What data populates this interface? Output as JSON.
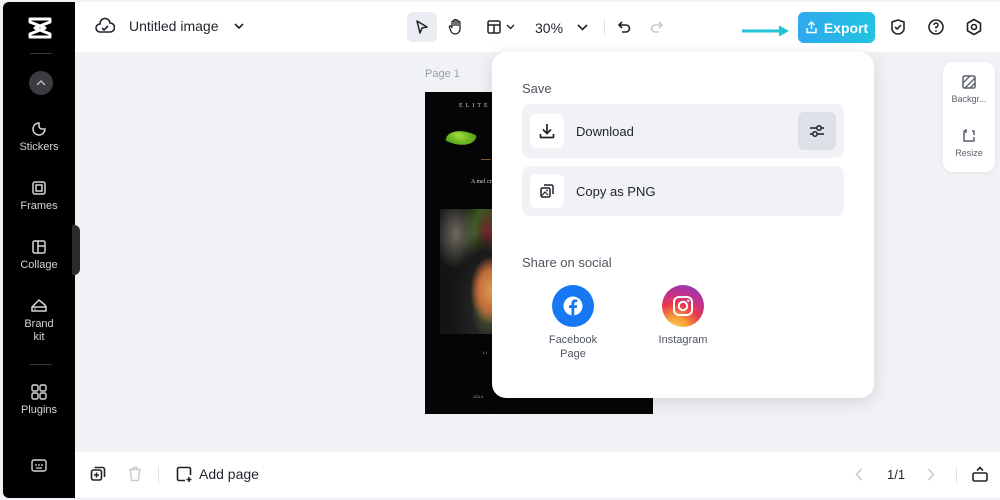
{
  "app": {
    "logo": "capcut-logo-icon"
  },
  "sidebar": {
    "collapse_icon": "chevron-up-icon",
    "items": [
      {
        "label": "Stickers",
        "icon": "sticker-icon"
      },
      {
        "label": "Frames",
        "icon": "frame-icon"
      },
      {
        "label": "Collage",
        "icon": "collage-icon"
      },
      {
        "label": "Brand\nkit",
        "label_line1": "Brand",
        "label_line2": "kit",
        "icon": "brand-kit-icon"
      },
      {
        "label": "Plugins",
        "icon": "plugins-icon"
      }
    ],
    "bottom_icon": "keyboard-shortcuts-icon"
  },
  "header": {
    "cloud_icon": "cloud-saved-icon",
    "title": "Untitled image",
    "zoom": "30%",
    "tools": [
      "select-pointer-icon",
      "hand-pan-icon",
      "layout-icon",
      "undo-icon",
      "redo-icon"
    ],
    "export_label": "Export",
    "right_icons": [
      "shield-check-icon",
      "help-icon",
      "settings-icon"
    ]
  },
  "canvas": {
    "page_label": "Page 1",
    "page_text_title": "ELITE EPICUR",
    "page_text_tagline": "A mel crea"
  },
  "export_menu": {
    "save_label": "Save",
    "options": [
      {
        "label": "Download",
        "icon": "download-icon",
        "settings_icon": "sliders-icon"
      },
      {
        "label": "Copy as PNG",
        "icon": "copy-image-icon"
      }
    ],
    "share_label": "Share on social",
    "social": [
      {
        "label_line1": "Facebook",
        "label_line2": "Page",
        "icon": "facebook-icon",
        "color": "#1877f2"
      },
      {
        "label_line1": "Instagram",
        "label_line2": "",
        "icon": "instagram-icon"
      }
    ]
  },
  "right_panel": {
    "items": [
      {
        "label": "Backgr...",
        "icon": "background-icon"
      },
      {
        "label": "Resize",
        "icon": "resize-icon"
      }
    ]
  },
  "footer": {
    "add_page_label": "Add page",
    "page_indicator": "1/1"
  },
  "colors": {
    "export_gradient_start": "#2ea9ef",
    "export_gradient_end": "#22c3e0",
    "annotation_arrow": "#22c3d6",
    "sidebar_bg": "#000000",
    "canvas_bg": "#f0f2f5"
  }
}
